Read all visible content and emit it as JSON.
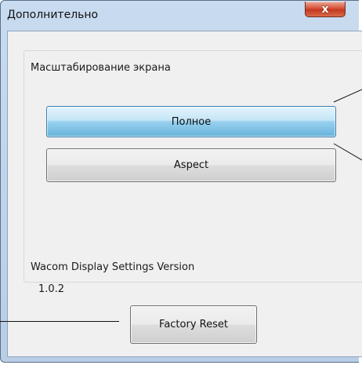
{
  "window": {
    "title": "Дополнительно",
    "close_glyph": "x"
  },
  "scaling": {
    "label": "Масштабирование экрана",
    "options": [
      {
        "label": "Полное",
        "selected": true
      },
      {
        "label": "Aspect",
        "selected": false
      }
    ]
  },
  "version": {
    "label": "Wacom Display Settings Version",
    "value": "1.0.2"
  },
  "footer": {
    "reset_label": "Factory Reset"
  },
  "colors": {
    "selected_button": "#98d1ef",
    "close_button": "#c4381e"
  }
}
